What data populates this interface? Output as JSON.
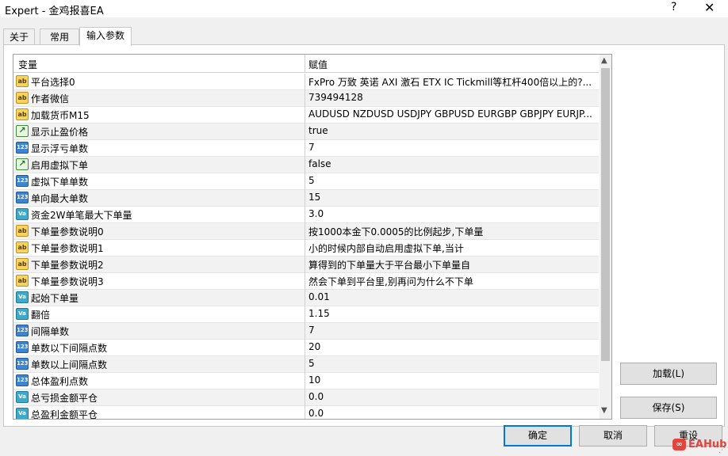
{
  "window": {
    "title": "Expert - 金鸡报喜EA",
    "help_glyph": "?",
    "close_glyph": "✕"
  },
  "tabs": [
    {
      "label": "关于",
      "active": false
    },
    {
      "label": "常用",
      "active": false
    },
    {
      "label": "输入参数",
      "active": true
    }
  ],
  "grid": {
    "headers": {
      "variable": "变量",
      "value": "赋值"
    },
    "rows": [
      {
        "icon": "ab",
        "name": "平台选择0",
        "value": "FxPro 万致 英诺 AXI 激石 ETX IC  Tickmill等杠杆400倍以上的?..."
      },
      {
        "icon": "ab",
        "name": "作者微信",
        "value": "739494128"
      },
      {
        "icon": "ab",
        "name": "加载货币M15",
        "value": "AUDUSD NZDUSD USDJPY GBPUSD EURGBP GBPJPY EURJP..."
      },
      {
        "icon": "bool",
        "name": "显示止盈价格",
        "value": "true"
      },
      {
        "icon": "123",
        "name": "显示浮亏单数",
        "value": "7"
      },
      {
        "icon": "bool",
        "name": "启用虚拟下单",
        "value": "false"
      },
      {
        "icon": "123",
        "name": "虚拟下单单数",
        "value": "5"
      },
      {
        "icon": "123",
        "name": "单向最大单数",
        "value": "15"
      },
      {
        "icon": "va",
        "name": "资金2W单笔最大下单量",
        "value": "3.0"
      },
      {
        "icon": "ab",
        "name": "下单量参数说明0",
        "value": "按1000本金下0.0005的比例起步,下单量"
      },
      {
        "icon": "ab",
        "name": "下单量参数说明1",
        "value": "小的时候内部自动启用虚拟下单,当计"
      },
      {
        "icon": "ab",
        "name": "下单量参数说明2",
        "value": "算得到的下单量大于平台最小下单量自"
      },
      {
        "icon": "ab",
        "name": "下单量参数说明3",
        "value": "然会下单到平台里,别再问为什么不下单"
      },
      {
        "icon": "va",
        "name": "起始下单量",
        "value": "0.01"
      },
      {
        "icon": "va",
        "name": "翻倍",
        "value": "1.15"
      },
      {
        "icon": "123",
        "name": "间隔单数",
        "value": "7"
      },
      {
        "icon": "123",
        "name": "单数以下间隔点数",
        "value": "20"
      },
      {
        "icon": "123",
        "name": "单数以上间隔点数",
        "value": "5"
      },
      {
        "icon": "123",
        "name": "总体盈利点数",
        "value": "10"
      },
      {
        "icon": "va",
        "name": "总亏损金额平仓",
        "value": "0.0"
      },
      {
        "icon": "va",
        "name": "总盈利金额平仓",
        "value": "0.0"
      }
    ],
    "icon_glyphs": {
      "ab": "ab",
      "123": "123",
      "va": "Va",
      "bool": "↗"
    }
  },
  "scrollbar": {
    "up_glyph": "▲",
    "down_glyph": "▼"
  },
  "buttons": {
    "load": "加载(L)",
    "save": "保存(S)",
    "ok": "确定",
    "cancel": "取消",
    "reset": "重设"
  },
  "watermark": {
    "text": "EAHub",
    "logo_glyph": "∞"
  }
}
